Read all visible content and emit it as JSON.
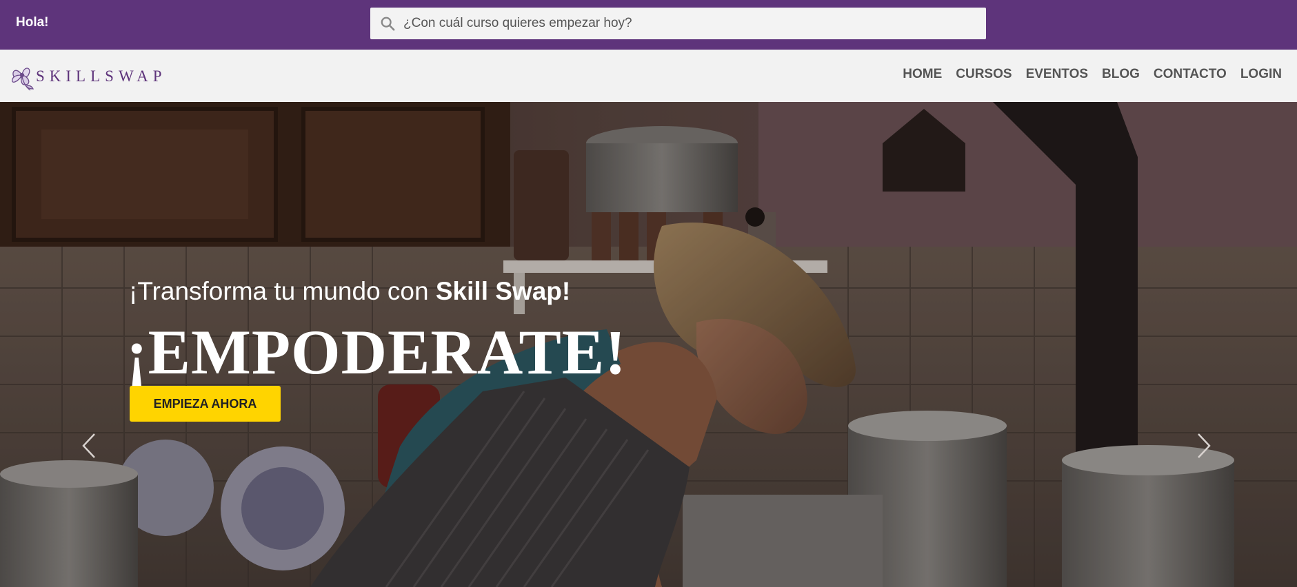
{
  "topbar": {
    "greeting": "Hola!",
    "search_placeholder": "¿Con cuál curso quieres empezar hoy?",
    "search_icon": "search-icon"
  },
  "brand": {
    "logo_text": "SKILLSWAP",
    "logo_icon": "flower-logo-icon",
    "color": "#5e347b"
  },
  "nav": {
    "items": [
      {
        "label": "HOME"
      },
      {
        "label": "CURSOS"
      },
      {
        "label": "EVENTOS"
      },
      {
        "label": "BLOG"
      },
      {
        "label": "CONTACTO"
      },
      {
        "label": "LOGIN"
      }
    ]
  },
  "hero": {
    "subtitle_prefix": "¡Transforma tu mundo con ",
    "subtitle_bold": "Skill Swap!",
    "headline": "¡EMPODERATE!",
    "cta_label": "EMPIEZA AHORA",
    "cta_color": "#ffd400",
    "prev_icon": "chevron-left-icon",
    "next_icon": "chevron-right-icon"
  }
}
